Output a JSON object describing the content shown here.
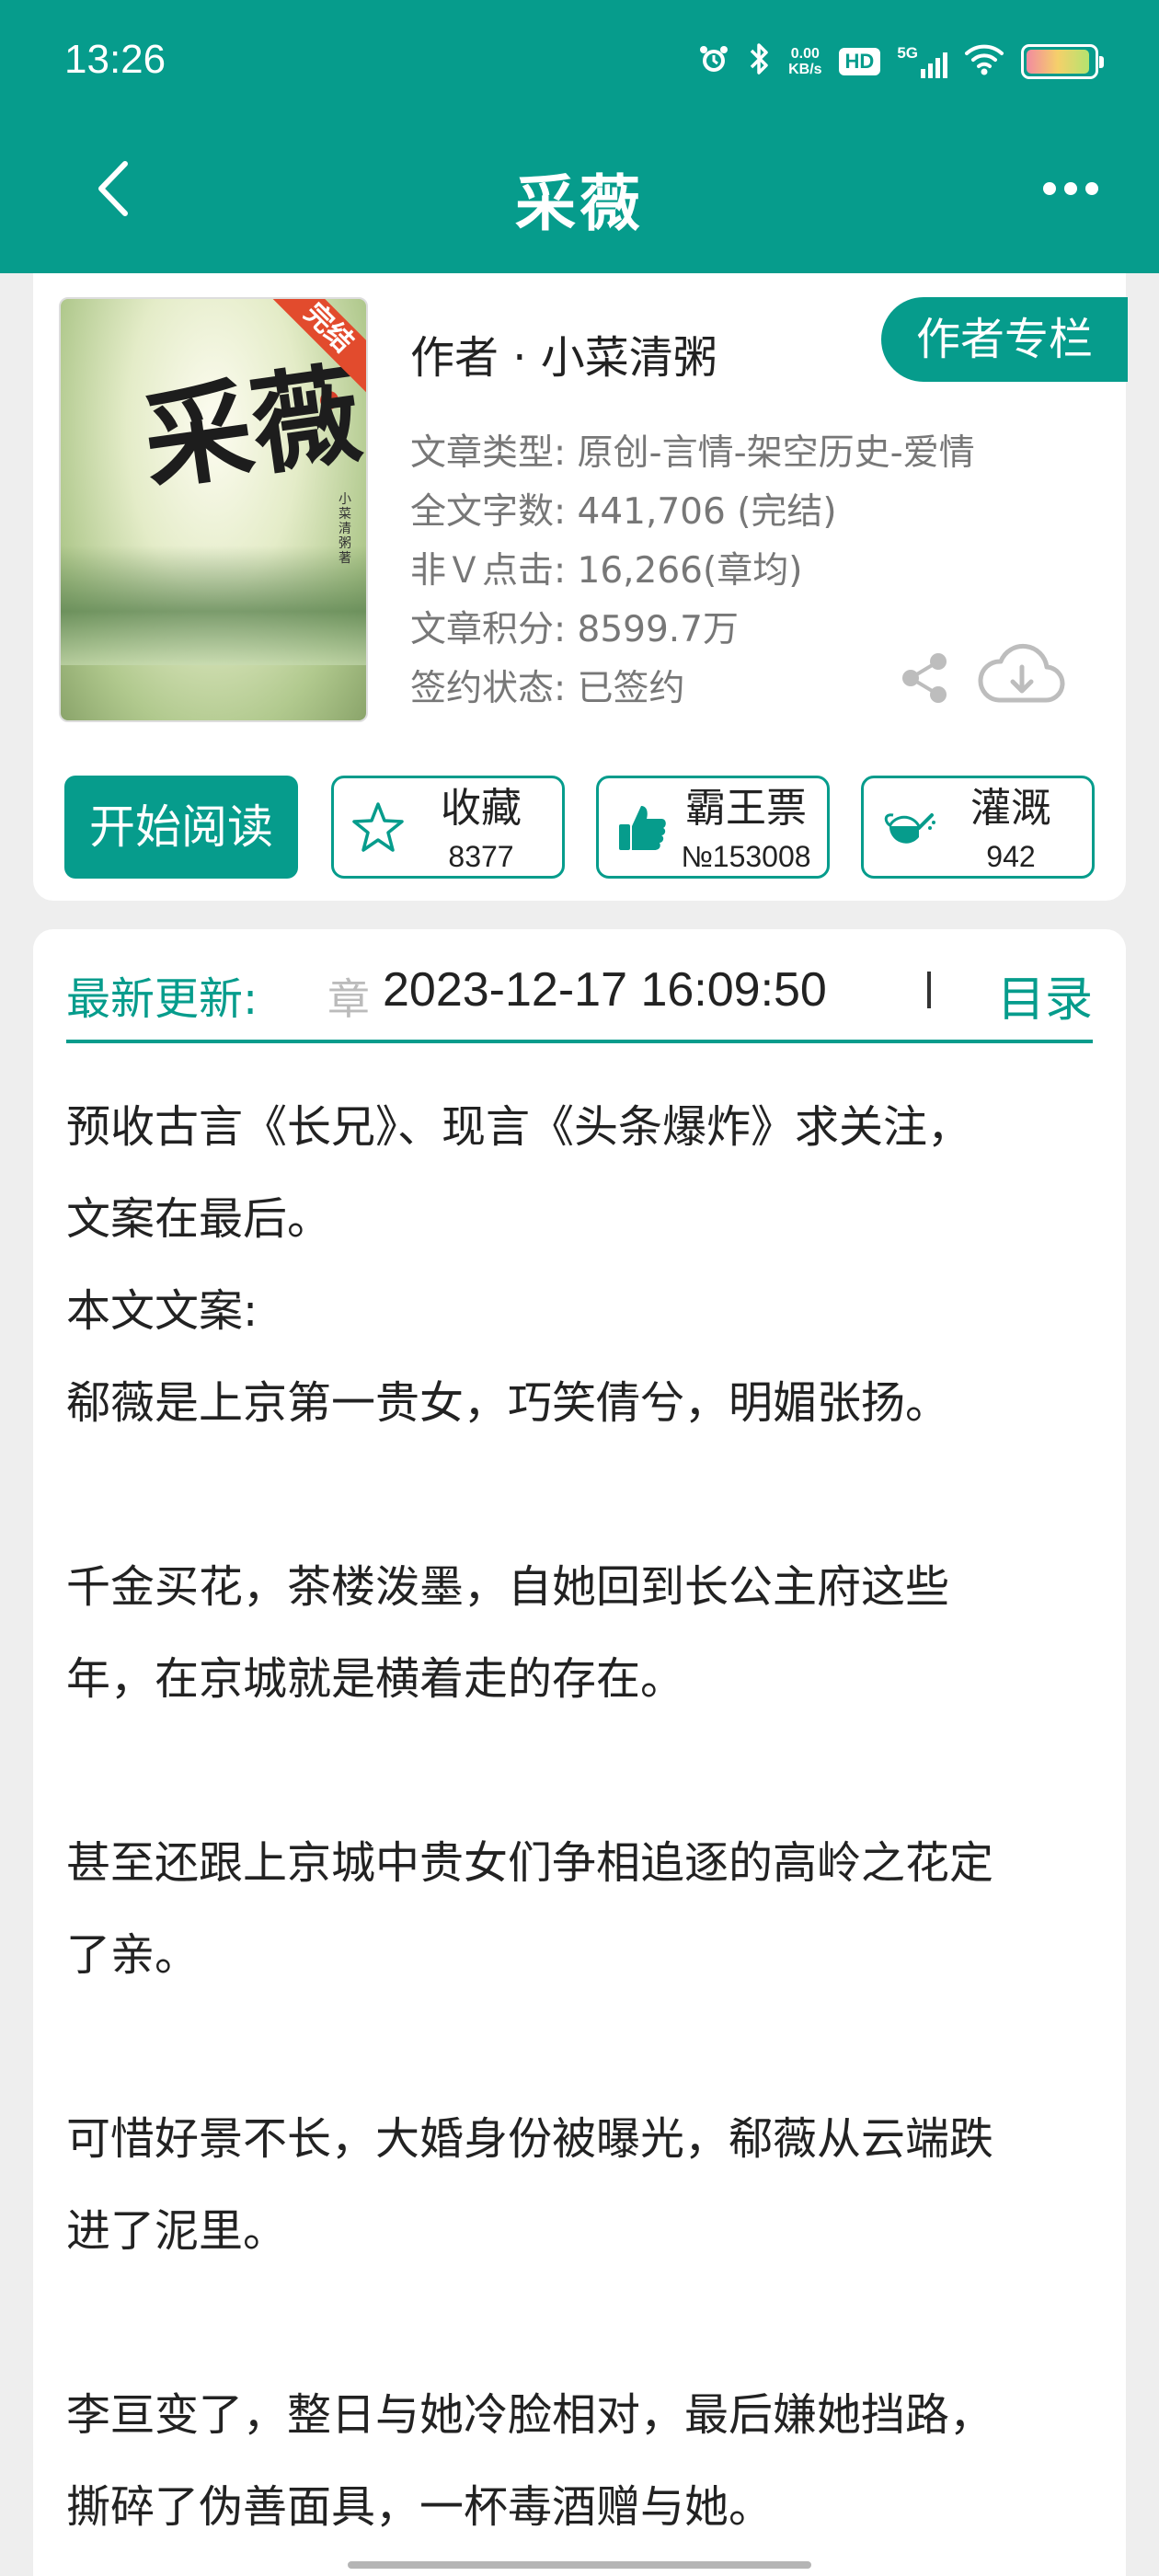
{
  "status_bar": {
    "time": "13:26",
    "net_speed_value": "0.00",
    "net_speed_unit": "KB/s",
    "hd": "HD",
    "network": "5G",
    "battery_level": 0.95
  },
  "header": {
    "title": "采薇"
  },
  "book": {
    "author_line": "作者 · 小菜清粥",
    "author_column": "作者专栏",
    "cover": {
      "calligraphy": "采薇",
      "badge": "完结",
      "tiny_text": "小菜清粥著"
    },
    "meta": [
      "文章类型: 原创-言情-架空历史-爱情",
      "全文字数: 441,706 (完结)",
      "非Ｖ点击: 16,266(章均)",
      "文章积分: 8599.7万",
      "签约状态: 已签约"
    ]
  },
  "actions": {
    "start_reading": "开始阅读",
    "favorite": {
      "label": "收藏",
      "count": "8377",
      "icon": "star-icon"
    },
    "overlord_ticket": {
      "label": "霸王票",
      "count": "№153008",
      "icon": "thumbs-up-icon"
    },
    "nutrient": {
      "label": "灌溉",
      "count": "942",
      "icon": "watering-can-icon"
    }
  },
  "update": {
    "label": "最新更新:",
    "chapter_fade": "章",
    "time": "2023-12-17 16:09:50",
    "toc": "目录"
  },
  "description": "预收古言《长兄》、现言《头条爆炸》求关注，\n文案在最后。\n本文文案:\n郗薇是上京第一贵女，巧笑倩兮，明媚张扬。\n\n千金买花，茶楼泼墨，自她回到长公主府这些\n年，在京城就是横着走的存在。\n\n甚至还跟上京城中贵女们争相追逐的高岭之花定\n了亲。\n\n可惜好景不长，大婚身份被曝光，郗薇从云端跌\n进了泥里。\n\n李亘变了，整日与她冷脸相对，最后嫌她挡路，\n撕碎了伪善面具，一杯毒酒赠与她。",
  "colors": {
    "accent": "#069c8c",
    "ribbon": "#e24b2d"
  }
}
